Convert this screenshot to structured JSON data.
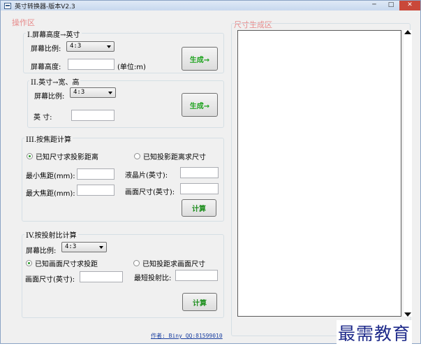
{
  "window": {
    "title": "英寸转换器-版本V2.3"
  },
  "left_panel": {
    "title": "操作区"
  },
  "right_panel": {
    "title": "尺寸生成区"
  },
  "section1": {
    "title": "I.屏幕高度→英寸",
    "ratio_label": "屏幕比例:",
    "ratio_value": "4:3",
    "height_label": "屏幕高度:",
    "height_value": "",
    "unit_label": "(单位:m)",
    "generate_label": "生成→"
  },
  "section2": {
    "title": "II.英寸→宽、高",
    "ratio_label": "屏幕比例:",
    "ratio_value": "4:3",
    "inch_label": "英    寸:",
    "inch_value": "",
    "generate_label": "生成→"
  },
  "section3": {
    "title": "III.按焦距计算",
    "radio_known_size": "已知尺寸求投影距离",
    "radio_known_distance": "已知投影距离求尺寸",
    "min_focal_label": "最小焦距(mm):",
    "max_focal_label": "最大焦距(mm):",
    "lcd_label": "液晶片(英寸):",
    "screen_size_label": "画面尺寸(英寸):",
    "calc_label": "计算"
  },
  "section4": {
    "title": "IV.按投射比计算",
    "ratio_label": "屏幕比例:",
    "ratio_value": "4:3",
    "radio_known_size": "已知画面尺寸求投距",
    "radio_known_distance": "已知投距求画面尺寸",
    "screen_size_label": "画面尺寸(英寸):",
    "throw_ratio_label": "最短投射比:",
    "calc_label": "计算"
  },
  "footer": {
    "author": "作者: Biny QQ:81599010"
  },
  "watermark": {
    "text": "最需教育"
  }
}
